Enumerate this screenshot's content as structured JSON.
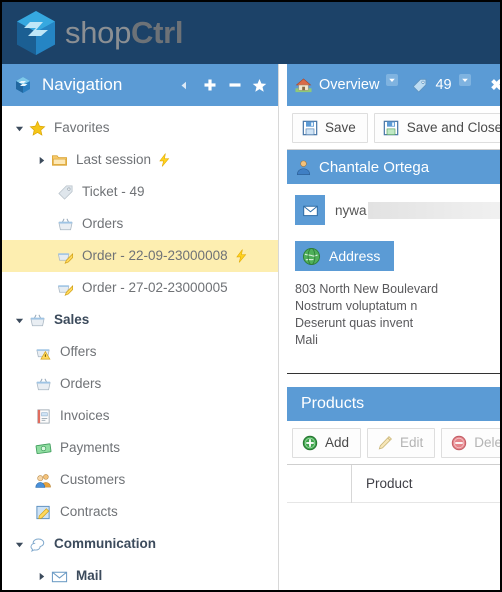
{
  "brand": {
    "logo_icon": "shopctrl-cube-logo",
    "name_light": "shop",
    "name_bold": "Ctrl"
  },
  "navigation": {
    "icon": "cube-icon",
    "title": "Navigation",
    "buttons": [
      {
        "name": "collapse-left-button",
        "icon": "caret-left-icon",
        "glyph": "◂"
      },
      {
        "name": "expand-all-button",
        "icon": "plus-icon",
        "glyph": "➕"
      },
      {
        "name": "collapse-all-button",
        "icon": "minus-icon",
        "glyph": "➖"
      },
      {
        "name": "favorites-button",
        "icon": "star-icon",
        "glyph": "★"
      }
    ],
    "tree": [
      {
        "label": "Favorites",
        "icon": "star-icon",
        "twisty": "down",
        "indent": 0,
        "bold": false,
        "selected": false,
        "bolt": false
      },
      {
        "label": "Last session",
        "icon": "folder-icon",
        "twisty": "right",
        "indent": 1,
        "bold": false,
        "selected": false,
        "bolt": true
      },
      {
        "label": "Ticket - 49",
        "icon": "tag-icon",
        "twisty": "none",
        "indent": 2,
        "bold": false,
        "selected": false,
        "bolt": false
      },
      {
        "label": "Orders",
        "icon": "basket-icon",
        "twisty": "none",
        "indent": 2,
        "bold": false,
        "selected": false,
        "bolt": false
      },
      {
        "label": "Order - 22-09-23000008",
        "icon": "order-icon",
        "twisty": "none",
        "indent": 2,
        "bold": false,
        "selected": true,
        "bolt": true
      },
      {
        "label": "Order - 27-02-23000005",
        "icon": "order-icon",
        "twisty": "none",
        "indent": 2,
        "bold": false,
        "selected": false,
        "bolt": false
      },
      {
        "label": "Sales",
        "icon": "basket-icon",
        "twisty": "down",
        "indent": 0,
        "bold": true,
        "selected": false,
        "bolt": false
      },
      {
        "label": "Offers",
        "icon": "offer-icon",
        "twisty": "none",
        "indent": 1,
        "bold": false,
        "selected": false,
        "bolt": false
      },
      {
        "label": "Orders",
        "icon": "basket-icon",
        "twisty": "none",
        "indent": 1,
        "bold": false,
        "selected": false,
        "bolt": false
      },
      {
        "label": "Invoices",
        "icon": "invoice-icon",
        "twisty": "none",
        "indent": 1,
        "bold": false,
        "selected": false,
        "bolt": false
      },
      {
        "label": "Payments",
        "icon": "money-icon",
        "twisty": "none",
        "indent": 1,
        "bold": false,
        "selected": false,
        "bolt": false
      },
      {
        "label": "Customers",
        "icon": "customers-icon",
        "twisty": "none",
        "indent": 1,
        "bold": false,
        "selected": false,
        "bolt": false
      },
      {
        "label": "Contracts",
        "icon": "contract-icon",
        "twisty": "none",
        "indent": 1,
        "bold": false,
        "selected": false,
        "bolt": false
      },
      {
        "label": "Communication",
        "icon": "chat-icon",
        "twisty": "down",
        "indent": 0,
        "bold": true,
        "selected": false,
        "bolt": false
      },
      {
        "label": "Mail",
        "icon": "envelope-icon",
        "twisty": "right",
        "indent": 1,
        "bold": true,
        "selected": false,
        "bolt": false
      }
    ]
  },
  "detail": {
    "tabs": [
      {
        "label": "Overview",
        "icon": "home-icon",
        "caret": true
      },
      {
        "label": "49",
        "icon": "tag-icon",
        "caret": true
      }
    ],
    "close_glyph": "✖",
    "toolbar": [
      {
        "label": "Save",
        "icon": "save-blue-icon",
        "disabled": false
      },
      {
        "label": "Save and Close",
        "icon": "save-green-icon",
        "disabled": false
      }
    ],
    "contact": {
      "icon": "person-icon",
      "name": "Chantale Ortega",
      "email_prefix": "nywa",
      "email_redacted": true,
      "email_icon": "envelope-icon",
      "address_button": {
        "label": "Address",
        "icon": "globe-icon"
      },
      "address_lines": [
        "803 North New Boulevard",
        "Nostrum voluptatum n",
        "Deserunt quas invent",
        "Mali"
      ]
    },
    "products": {
      "title": "Products",
      "toolbar": [
        {
          "label": "Add",
          "icon": "plus-circle-green-icon",
          "disabled": false
        },
        {
          "label": "Edit",
          "icon": "pencil-icon",
          "disabled": true
        },
        {
          "label": "Delete",
          "icon": "minus-circle-red-icon",
          "disabled": true
        }
      ],
      "columns": [
        "",
        "Product"
      ]
    }
  },
  "colors": {
    "brandbar": "#1c4268",
    "panel_header": "#5b9bd5",
    "selected_row": "#fdeeb0",
    "text_grey": "#6f7276"
  }
}
